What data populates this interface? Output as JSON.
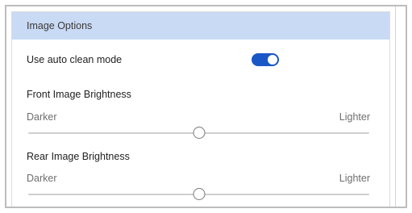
{
  "panel": {
    "title": "Image Options"
  },
  "auto_clean": {
    "label": "Use auto clean mode",
    "enabled": true
  },
  "front_brightness": {
    "title": "Front Image Brightness",
    "min_label": "Darker",
    "max_label": "Lighter",
    "value_fraction": 0.5
  },
  "rear_brightness": {
    "title": "Rear Image Brightness",
    "min_label": "Darker",
    "max_label": "Lighter",
    "value_fraction": 0.5
  },
  "colors": {
    "header_bg": "#c9daf5",
    "toggle_on": "#1a57c6"
  }
}
